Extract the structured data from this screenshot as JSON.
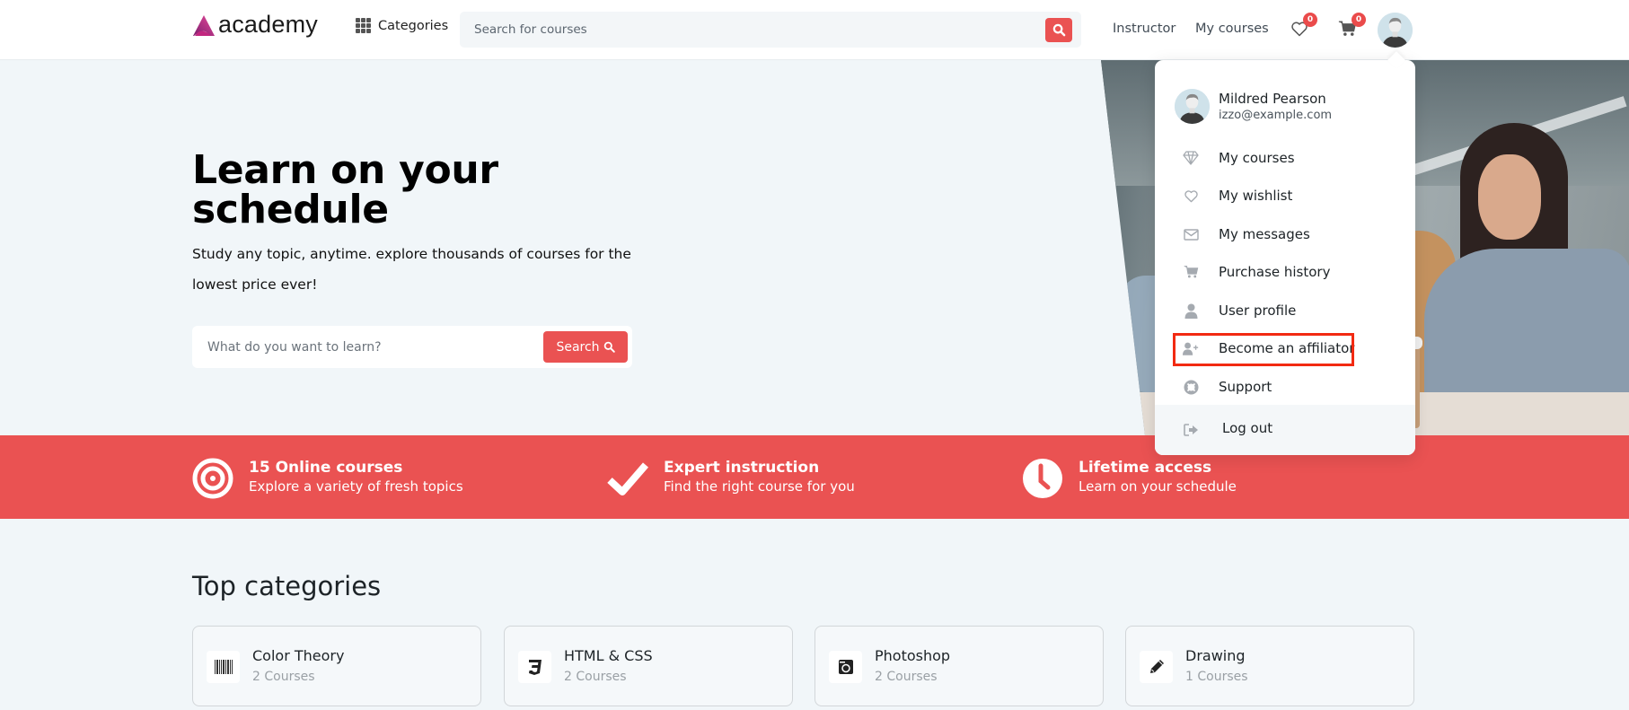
{
  "header": {
    "logo_text": "academy",
    "categories_label": "Categories",
    "search_placeholder": "Search for courses",
    "nav_links": [
      "Instructor",
      "My courses"
    ],
    "wishlist_count": "0",
    "cart_count": "0"
  },
  "hero": {
    "title": "Learn on your schedule",
    "subtitle": "Study any topic, anytime. explore thousands of courses for the lowest price ever!",
    "search_placeholder": "What do you want to learn?",
    "search_button": "Search"
  },
  "features": [
    {
      "icon": "target-icon",
      "title": "15 Online courses",
      "desc": "Explore a variety of fresh topics"
    },
    {
      "icon": "check-icon",
      "title": "Expert instruction",
      "desc": "Find the right course for you"
    },
    {
      "icon": "clock-icon",
      "title": "Lifetime access",
      "desc": "Learn on your schedule"
    }
  ],
  "top_categories": {
    "title": "Top categories",
    "items": [
      {
        "name": "Color Theory",
        "count": "2 Courses",
        "icon": "barcode-icon"
      },
      {
        "name": "HTML & CSS",
        "count": "2 Courses",
        "icon": "css3-icon"
      },
      {
        "name": "Photoshop",
        "count": "2 Courses",
        "icon": "camera-window-icon"
      },
      {
        "name": "Drawing",
        "count": "1 Courses",
        "icon": "pencil-icon"
      }
    ]
  },
  "user_menu": {
    "name": "Mildred Pearson",
    "email": "izzo@example.com",
    "items": [
      {
        "label": "My courses",
        "icon": "diamond-icon"
      },
      {
        "label": "My wishlist",
        "icon": "heart-icon"
      },
      {
        "label": "My messages",
        "icon": "envelope-icon"
      },
      {
        "label": "Purchase history",
        "icon": "cart-icon"
      },
      {
        "label": "User profile",
        "icon": "user-icon"
      },
      {
        "label": "Become an affiliator",
        "icon": "user-plus-icon",
        "highlighted": true
      },
      {
        "label": "Support",
        "icon": "life-ring-icon"
      }
    ],
    "logout_label": "Log out"
  },
  "colors": {
    "accent": "#ea5252",
    "highlight_border": "#f22a12",
    "background": "#f1f6f9"
  }
}
